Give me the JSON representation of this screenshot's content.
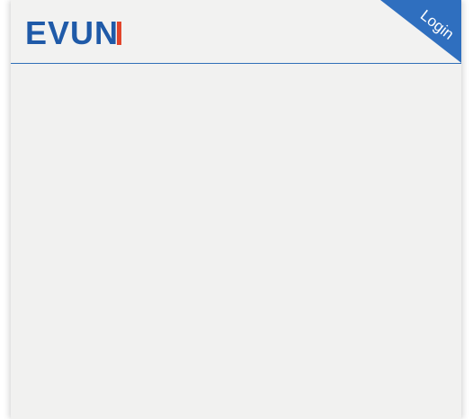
{
  "header": {
    "logo_text": "EVUN",
    "brand_color": "#1f5aa8",
    "accent_color": "#e2452b",
    "login_label": "Login",
    "ribbon_color": "#2f6fbf"
  }
}
